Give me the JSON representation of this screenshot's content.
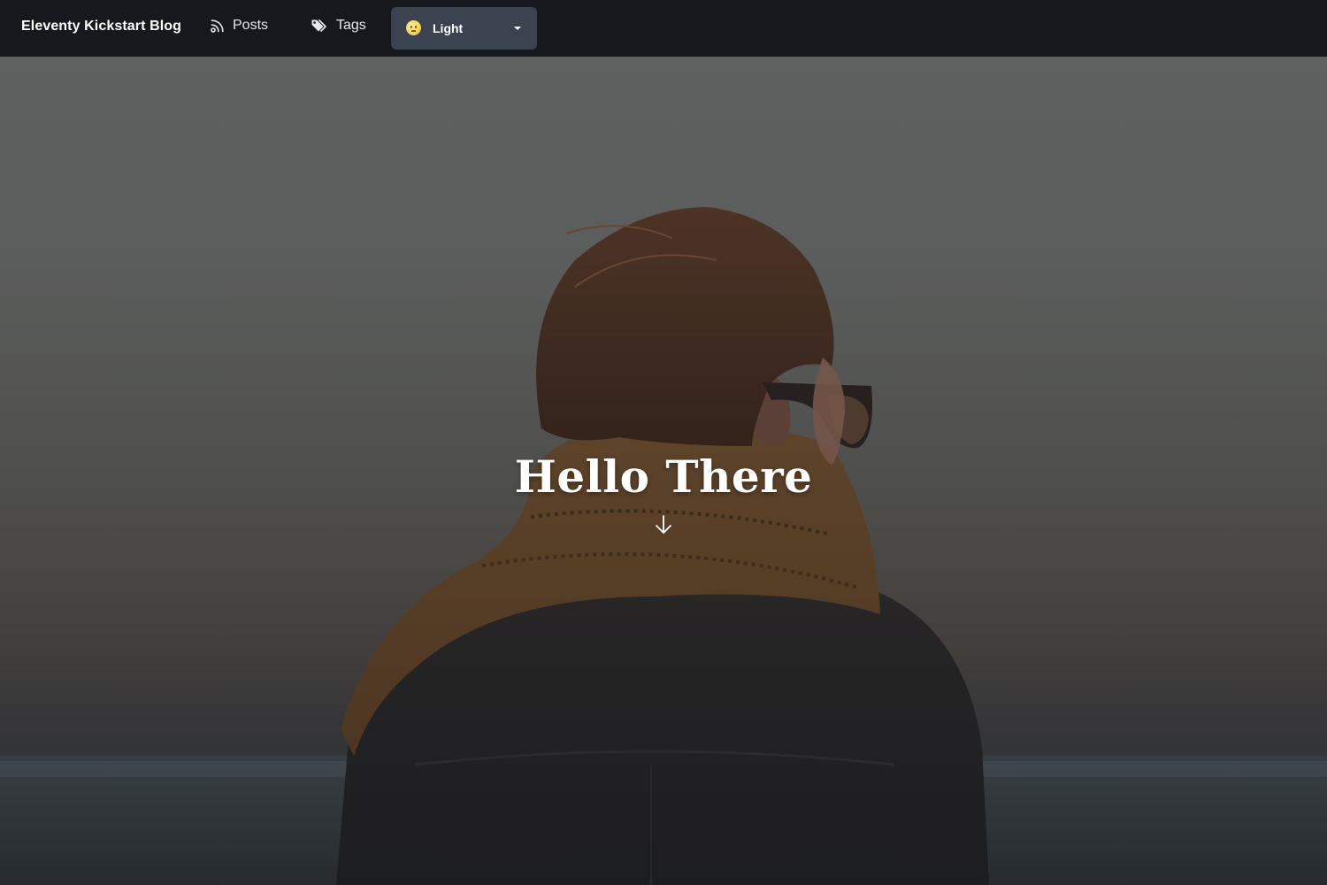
{
  "navbar": {
    "brand": "Eleventy Kickstart Blog",
    "links": [
      {
        "label": "Posts",
        "icon": "rss-icon"
      },
      {
        "label": "Tags",
        "icon": "tags-icon"
      }
    ],
    "theme_select": {
      "selected": "Light",
      "icon": "face-icon"
    }
  },
  "hero": {
    "title": "Hello There",
    "scroll_icon": "arrow-down-icon"
  },
  "colors": {
    "navbar_bg": "#16181e",
    "theme_select_bg": "#3b4250",
    "text": "#ffffff"
  }
}
